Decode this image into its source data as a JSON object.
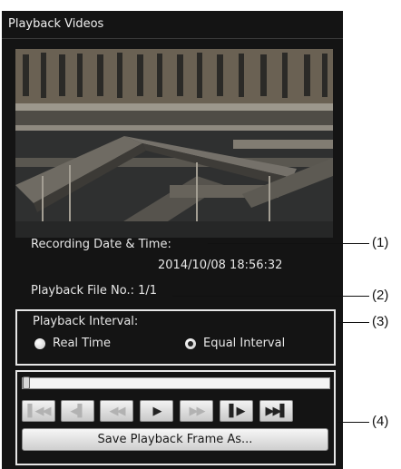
{
  "window": {
    "title": "Playback Videos"
  },
  "recording": {
    "label": "Recording Date & Time:",
    "value": "2014/10/08 18:56:32"
  },
  "file": {
    "label": "Playback File No.: 1/1"
  },
  "interval": {
    "label": "Playback Interval:",
    "options": [
      {
        "label": "Real Time",
        "selected": false
      },
      {
        "label": "Equal Interval",
        "selected": true
      }
    ]
  },
  "slider": {
    "position": 0
  },
  "controls": [
    {
      "name": "skip-to-start",
      "glyph": "▌◀◀"
    },
    {
      "name": "frame-back",
      "glyph": "◀▌"
    },
    {
      "name": "rewind",
      "glyph": "◀◀"
    },
    {
      "name": "play",
      "glyph": "▶"
    },
    {
      "name": "fast-forward",
      "glyph": "▶▶"
    },
    {
      "name": "frame-forward",
      "glyph": "▌▶"
    },
    {
      "name": "skip-to-end",
      "glyph": "▶▶▌"
    }
  ],
  "save_button": {
    "label": "Save Playback Frame As..."
  },
  "callouts": [
    "(1)",
    "(2)",
    "(3)",
    "(4)"
  ],
  "colors": {
    "panel": "#141414",
    "text": "#e6e6e6",
    "accent": "#e6e6e6"
  }
}
